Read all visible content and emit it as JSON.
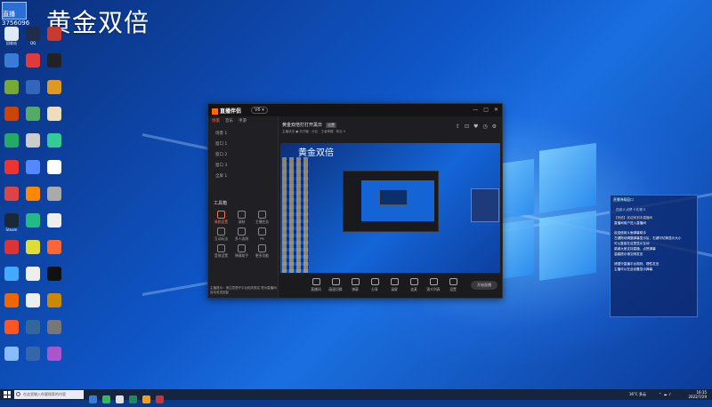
{
  "desktop": {
    "headline": "黄金双倍",
    "badge_id": "3756096",
    "badge_logo": "直播",
    "icons": [
      {
        "label": "回收站",
        "color": "#dfe9f7"
      },
      {
        "label": "QQ",
        "color": "#1f2d4a"
      },
      {
        "label": "",
        "color": "#c83a2d"
      },
      {
        "label": "",
        "color": "#3a7bd5"
      },
      {
        "label": "",
        "color": "#e23a3a"
      },
      {
        "label": "",
        "color": "#222"
      },
      {
        "label": "",
        "color": "#7a3"
      },
      {
        "label": "",
        "color": "#36b"
      },
      {
        "label": "",
        "color": "#d92"
      },
      {
        "label": "",
        "color": "#c40"
      },
      {
        "label": "",
        "color": "#5a6"
      },
      {
        "label": "",
        "color": "#edb"
      },
      {
        "label": "",
        "color": "#2a6"
      },
      {
        "label": "",
        "color": "#ccc"
      },
      {
        "label": "",
        "color": "#3c9"
      },
      {
        "label": "",
        "color": "#e33"
      },
      {
        "label": "",
        "color": "#58f"
      },
      {
        "label": "",
        "color": "#fff"
      },
      {
        "label": "",
        "color": "#d44"
      },
      {
        "label": "",
        "color": "#f80"
      },
      {
        "label": "",
        "color": "#aaa"
      },
      {
        "label": "Steam",
        "color": "#1b2838"
      },
      {
        "label": "",
        "color": "#2b8"
      },
      {
        "label": "",
        "color": "#eee"
      },
      {
        "label": "",
        "color": "#d33"
      },
      {
        "label": "",
        "color": "#dd3"
      },
      {
        "label": "",
        "color": "#f63"
      },
      {
        "label": "",
        "color": "#4af"
      },
      {
        "label": "",
        "color": "#eee"
      },
      {
        "label": "",
        "color": "#111"
      },
      {
        "label": "",
        "color": "#e60"
      },
      {
        "label": "",
        "color": "#eee"
      },
      {
        "label": "",
        "color": "#c80"
      },
      {
        "label": "",
        "color": "#f52"
      },
      {
        "label": "",
        "color": "#369"
      },
      {
        "label": "",
        "color": "#777"
      },
      {
        "label": "",
        "color": "#8bf"
      },
      {
        "label": "",
        "color": "#36a"
      },
      {
        "label": "",
        "color": "#a5c"
      }
    ]
  },
  "app": {
    "name": "直播伴侣",
    "version": "V6 ▾",
    "window_controls": [
      "—",
      "□",
      "✕"
    ],
    "left_tabs": [
      {
        "label": "场景",
        "active": true
      },
      {
        "label": "音乐",
        "active": false
      },
      {
        "label": "手游",
        "active": false
      }
    ],
    "scenes": [
      "场景 1",
      "窗口 1",
      "窗口 2",
      "窗口 3",
      "全屏 1"
    ],
    "toolbox_title": "工具箱",
    "tools": [
      "美颜设置",
      "录制",
      "主播任务",
      "互动玩法",
      "多人连线",
      "PK",
      "音效设置",
      "弹幕助手",
      "更多功能"
    ],
    "footer_text": "主播提示：请注意遵守平台相关规定 提示直播间自动发送回复",
    "live_title": "黄金双倍打打开黑日",
    "live_tag": "设置",
    "live_meta": "主播状态 ● 未开播 · 分区 · 王者荣耀 · 粉丝 0",
    "preview_title": "黄金双倍",
    "controls": [
      "直播间",
      "画面切换",
      "弹幕",
      "分享",
      "录屏",
      "连麦",
      "观众列表",
      "设置"
    ],
    "go_live_label": "开始直播"
  },
  "chat": {
    "header": "直播弹幕窗口",
    "stats": [
      "在线 0",
      "点赞 0",
      "礼物 0"
    ],
    "lines": [
      {
        "text": "【系统】欢迎来到本直播间",
        "warn": true
      },
      {
        "text": "直播间用户进入直播间",
        "warn": false
      },
      {
        "text": "",
        "warn": false
      },
      {
        "text": "欢迎使用斗鱼弹幕助手",
        "warn": false
      },
      {
        "text": "左键拖动调整弹幕显示区，右键可切换显示大小",
        "warn": false
      },
      {
        "text": "可以直接在这里显示互动",
        "warn": false
      },
      {
        "text": "感谢大家支持直播，点赞弹幕",
        "warn": false
      },
      {
        "text": "温馨提示请文明发言",
        "warn": false
      },
      {
        "text": "",
        "warn": false
      },
      {
        "text": "请遵守直播平台规则，理性发言",
        "warn": false
      },
      {
        "text": "主播可以在此设置显示弹幕",
        "warn": false
      }
    ]
  },
  "taskbar": {
    "search_placeholder": "在这里输入你要搜索的内容",
    "weather": "16°C 多云",
    "time": "16:35",
    "date": "2022/7/29",
    "apps": [
      "#3a7bd5",
      "#2fbd5a",
      "#e0e0e0",
      "#1b8a5a",
      "#f0a020",
      "#c33"
    ]
  }
}
